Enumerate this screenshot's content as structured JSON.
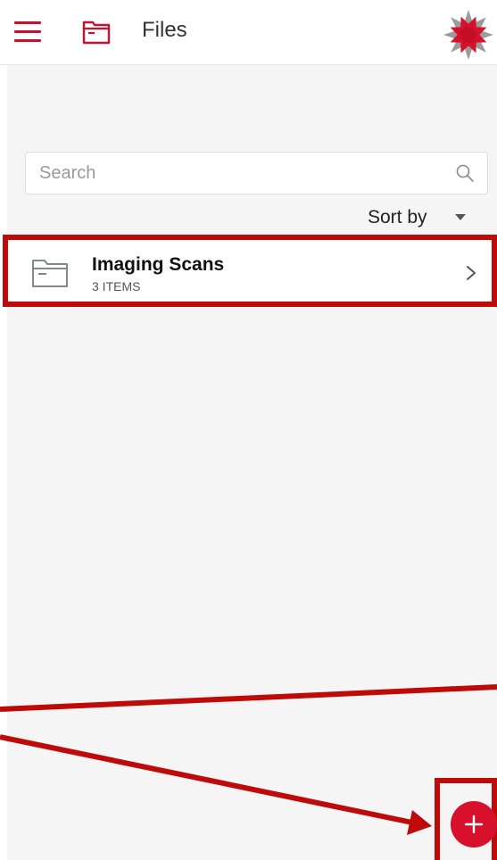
{
  "header": {
    "title": "Files",
    "menu_icon": "hamburger-menu-icon",
    "folder_icon": "folder-icon",
    "logo": "star-logo"
  },
  "search": {
    "placeholder": "Search",
    "icon": "search-icon"
  },
  "sort": {
    "label": "Sort by",
    "icon": "caret-down-icon"
  },
  "files": [
    {
      "name": "Imaging Scans",
      "count": "3 ITEMS",
      "icon": "folder-icon",
      "chevron": "chevron-right-icon"
    }
  ],
  "fab": {
    "icon": "plus-icon"
  },
  "colors": {
    "accent": "#c8102e",
    "annotation": "#bf0a0a",
    "background": "#f5f5f5",
    "logo_gray": "#9b9b9b"
  }
}
